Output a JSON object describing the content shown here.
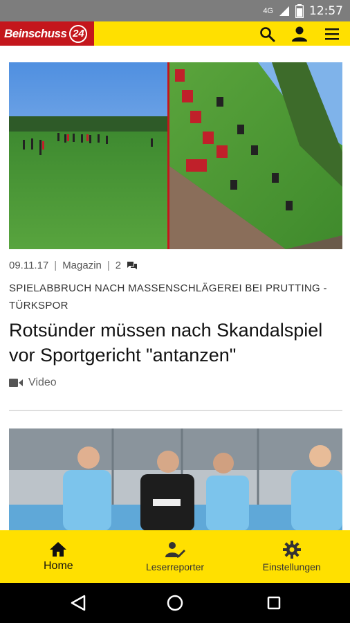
{
  "status_bar": {
    "network": "4G",
    "time": "12:57"
  },
  "app_bar": {
    "logo_text": "Beinschuss",
    "logo_tag": "regional",
    "logo_number": "24",
    "search_icon": "search-icon",
    "account_icon": "account-icon",
    "menu_icon": "menu-icon"
  },
  "articles": [
    {
      "date": "09.11.17",
      "category": "Magazin",
      "comments": "2",
      "kicker": "SPIELABBRUCH NACH MASSENSCHLÄGEREI BEI PRUTTING - TÜRKSPOR",
      "headline": "Rotsünder müssen nach Skandalspiel vor Sportgericht \"antanzen\"",
      "media_label": "Video"
    }
  ],
  "bottom_nav": [
    {
      "label": "Home",
      "icon": "home-icon",
      "active": true
    },
    {
      "label": "Leserreporter",
      "icon": "reporter-icon",
      "active": false
    },
    {
      "label": "Einstellungen",
      "icon": "gear-icon",
      "active": false
    }
  ],
  "colors": {
    "brand_yellow": "#ffe000",
    "brand_red": "#c4161c"
  }
}
